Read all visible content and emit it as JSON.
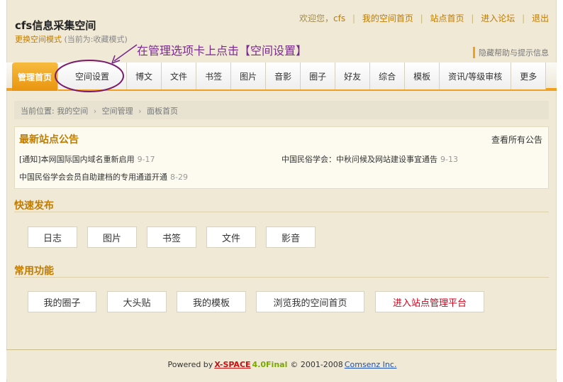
{
  "header": {
    "site_title": "cfs信息采集空间",
    "mode_link": "更换空间模式",
    "mode_current": "(当前为:收藏模式)",
    "help_toggle": "隐藏帮助与提示信息"
  },
  "top_nav": {
    "welcome": "欢迎您，",
    "username": "cfs",
    "my_space_home": "我的空间首页",
    "site_home": "站点首页",
    "enter_forum": "进入论坛",
    "logout": "退出"
  },
  "annotation": {
    "text": "在管理选项卡上点击【空间设置】",
    "color": "#7a2a8c"
  },
  "tabs": [
    {
      "label": "管理首页",
      "active": true
    },
    {
      "label": "空间设置",
      "active": false
    },
    {
      "label": "博文",
      "active": false
    },
    {
      "label": "文件",
      "active": false
    },
    {
      "label": "书签",
      "active": false
    },
    {
      "label": "图片",
      "active": false
    },
    {
      "label": "音影",
      "active": false
    },
    {
      "label": "圈子",
      "active": false
    },
    {
      "label": "好友",
      "active": false
    },
    {
      "label": "综合",
      "active": false
    },
    {
      "label": "模板",
      "active": false
    },
    {
      "label": "资讯/等级审核",
      "active": false
    },
    {
      "label": "更多",
      "active": false
    }
  ],
  "breadcrumb": {
    "prefix": "当前位置:",
    "items": [
      "我的空间",
      "空间管理",
      "面板首页"
    ]
  },
  "announcements": {
    "title": "最新站点公告",
    "view_all": "查看所有公告",
    "items": [
      {
        "text": "[通知]本网国际国内域名重新启用",
        "date": "9-17"
      },
      {
        "text": "中国民俗学会：中秋问候及网站建设事宜通告",
        "date": "9-13"
      },
      {
        "text": "中国民俗学会会员自助建档的专用通道开通",
        "date": "8-29"
      }
    ]
  },
  "quick_publish": {
    "title": "快速发布",
    "buttons": [
      "日志",
      "图片",
      "书签",
      "文件",
      "影音"
    ]
  },
  "common_functions": {
    "title": "常用功能",
    "buttons": [
      "我的圈子",
      "大头贴",
      "我的模板",
      "浏览我的空间首页",
      "进入站点管理平台"
    ]
  },
  "footer": {
    "powered_by": "Powered by",
    "brand": "X-SPACE",
    "version": "4.0Final",
    "copyright": "© 2001-2008",
    "company": "Comsenz Inc."
  },
  "colors": {
    "accent": "#f0a020",
    "section_title": "#c07c00",
    "admin_link": "#d0021b"
  }
}
